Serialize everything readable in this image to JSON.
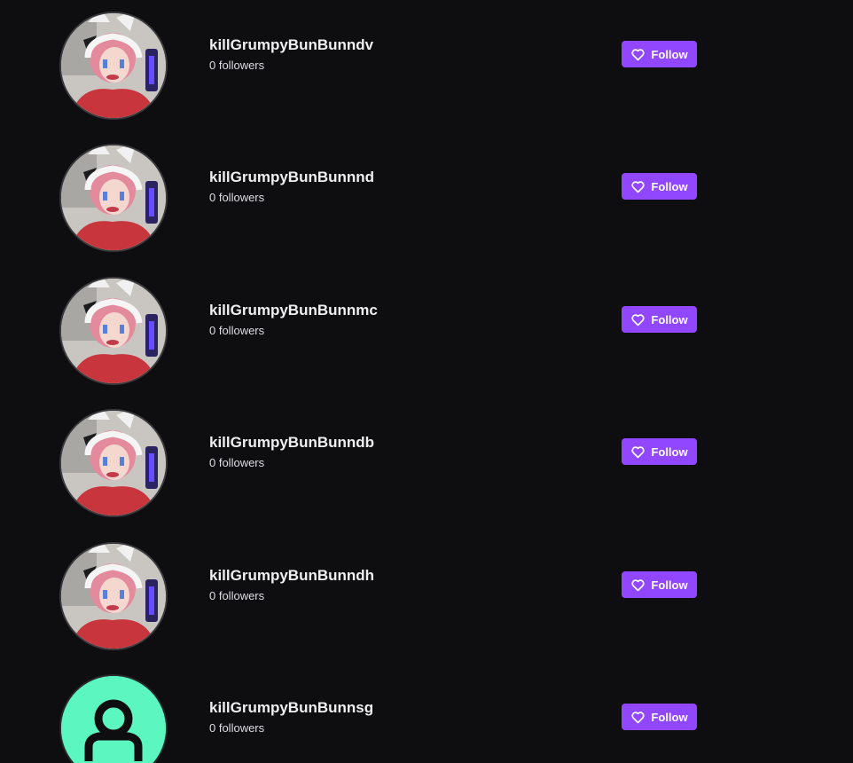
{
  "users": [
    {
      "name": "killGrumpyBunBunndv",
      "followers": "0 followers",
      "follow_label": "Follow",
      "avatar": "photo"
    },
    {
      "name": "killGrumpyBunBunnnd",
      "followers": "0 followers",
      "follow_label": "Follow",
      "avatar": "photo"
    },
    {
      "name": "killGrumpyBunBunnmc",
      "followers": "0 followers",
      "follow_label": "Follow",
      "avatar": "photo"
    },
    {
      "name": "killGrumpyBunBunndb",
      "followers": "0 followers",
      "follow_label": "Follow",
      "avatar": "photo"
    },
    {
      "name": "killGrumpyBunBunndh",
      "followers": "0 followers",
      "follow_label": "Follow",
      "avatar": "photo"
    },
    {
      "name": "killGrumpyBunBunnsg",
      "followers": "0 followers",
      "follow_label": "Follow",
      "avatar": "default-user-icon"
    }
  ],
  "colors": {
    "background": "#0e0e10",
    "accent": "#9147ff",
    "default_avatar_bg": "#5cf7c0"
  },
  "icons": {
    "follow": "heart-icon"
  }
}
